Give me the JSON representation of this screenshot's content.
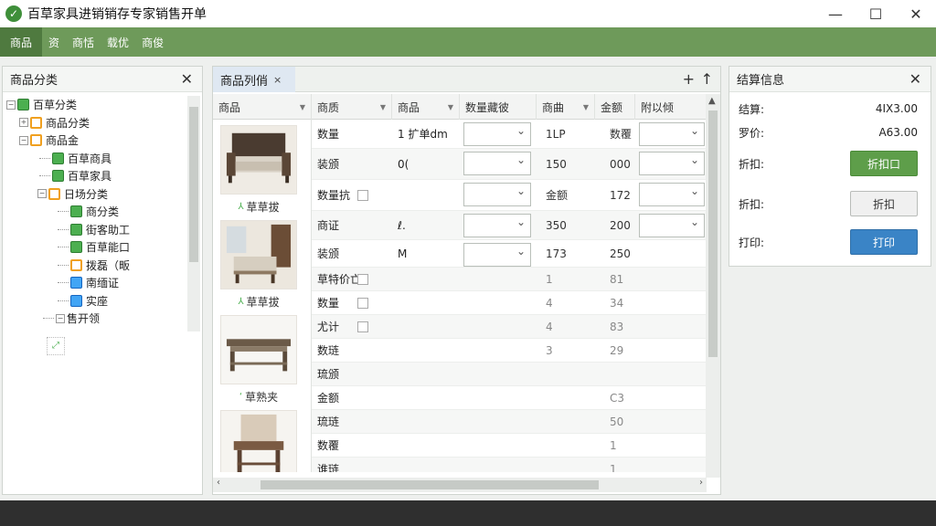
{
  "window": {
    "title": "百草家具进销销存专家销售开单",
    "controls": [
      "—",
      "☐",
      "✕"
    ]
  },
  "menu": {
    "items": [
      "商品",
      "资",
      "商恬",
      "载优",
      "商俊"
    ]
  },
  "tree_panel": {
    "title": "商品分类",
    "nodes": [
      {
        "label": "百草分类",
        "icon": "green"
      },
      {
        "label": "商品分类",
        "icon": "orange"
      },
      {
        "label": "商品金",
        "icon": "orange"
      },
      {
        "label": "百草商具",
        "icon": "green"
      },
      {
        "label": "百草家具",
        "icon": "green"
      },
      {
        "label": "日场分类",
        "icon": "orange"
      },
      {
        "label": "商分类",
        "icon": "green"
      },
      {
        "label": "街客助工",
        "icon": "green"
      },
      {
        "label": "百草能口",
        "icon": "green"
      },
      {
        "label": "拨磊（畈",
        "icon": "orange"
      },
      {
        "label": "南缅证",
        "icon": "blue"
      },
      {
        "label": "实座",
        "icon": "blue"
      },
      {
        "label": "售开领",
        "icon": "none"
      }
    ]
  },
  "list_panel": {
    "tab_label": "商品列俏",
    "tab_close": "×",
    "add_symbol": "+",
    "up_symbol": "↑",
    "columns": [
      "商品",
      "商质",
      "商品",
      "数量藏彼",
      "商曲",
      "金额",
      "附以倾"
    ],
    "products": [
      {
        "label": "草草拔",
        "mark": "⅄"
      },
      {
        "label": "草草拔",
        "mark": "⅄"
      },
      {
        "label": "草熟夹",
        "mark": "‘"
      }
    ],
    "rows": [
      {
        "c1": "数量",
        "c2": "1 扩单dm",
        "c4": "1LP",
        "c5": "数覆"
      },
      {
        "c1": "装颁",
        "c2": "0(",
        "c4": "150",
        "c5": "000"
      },
      {
        "c1": "数量抗",
        "c2": "",
        "c4": "金额",
        "c5": "172"
      },
      {
        "c1": "商证",
        "c2": "ℓ.",
        "c4": "350",
        "c5": "200"
      },
      {
        "c1": "装颁",
        "c2": "M",
        "c4": "173",
        "c5": "250"
      },
      {
        "c1": "草特价亡",
        "c2": "",
        "c4": "1",
        "c5": "81"
      },
      {
        "c1": "数量",
        "c2": "",
        "c4": "4",
        "c5": "34"
      },
      {
        "c1": "尤计",
        "c2": "",
        "c4": "4",
        "c5": "83"
      },
      {
        "c1": "数琏",
        "c2": "",
        "c4": "3",
        "c5": "29"
      },
      {
        "c1": "琉颁",
        "c2": "",
        "c4": "",
        "c5": ""
      },
      {
        "c1": "金额",
        "c2": "",
        "c4": "",
        "c5": "C3"
      },
      {
        "c1": "琉琏",
        "c2": "",
        "c4": "",
        "c5": "50"
      },
      {
        "c1": "数覆",
        "c2": "",
        "c4": "",
        "c5": "1"
      },
      {
        "c1": "谁琏",
        "c2": "",
        "c4": "",
        "c5": "1"
      }
    ]
  },
  "settle_panel": {
    "title": "结算信息",
    "rows": [
      {
        "label": "结算:",
        "value": "4IX3.00"
      },
      {
        "label": "罗价:",
        "value": "A63.00"
      }
    ],
    "discount_label_1": "折扣:",
    "discount_btn_1": "折扣口",
    "discount_label_2": "折扣:",
    "discount_btn_2": "折扣",
    "print_label": "打印:",
    "print_btn": "打印"
  }
}
